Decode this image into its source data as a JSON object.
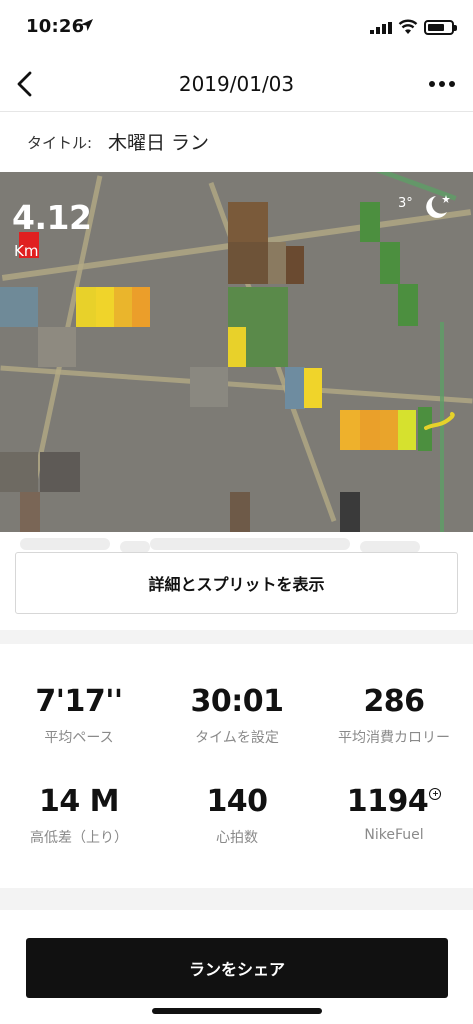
{
  "status": {
    "time": "10:26"
  },
  "nav": {
    "title": "2019/01/03"
  },
  "run": {
    "title_label": "タイトル:",
    "title_value": "木曜日 ラン"
  },
  "map": {
    "distance": "4.12",
    "unit": "Km",
    "weather_temp": "3°"
  },
  "details_button": "詳細とスプリットを表示",
  "stats": [
    {
      "value": "7'17''",
      "label": "平均ペース"
    },
    {
      "value": "30:01",
      "label": "タイムを設定"
    },
    {
      "value": "286",
      "label": "平均消費カロリー"
    },
    {
      "value": "14 M",
      "label": "高低差（上り）"
    },
    {
      "value": "140",
      "label": "心拍数"
    },
    {
      "value": "1194",
      "label": "NikeFuel"
    }
  ],
  "share_button": "ランをシェア",
  "colors": {
    "pace_fast": "#4c8f3f",
    "pace_mid": "#e8d12a",
    "pace_slow": "#e02020",
    "pace_orange": "#eb9e2a"
  }
}
